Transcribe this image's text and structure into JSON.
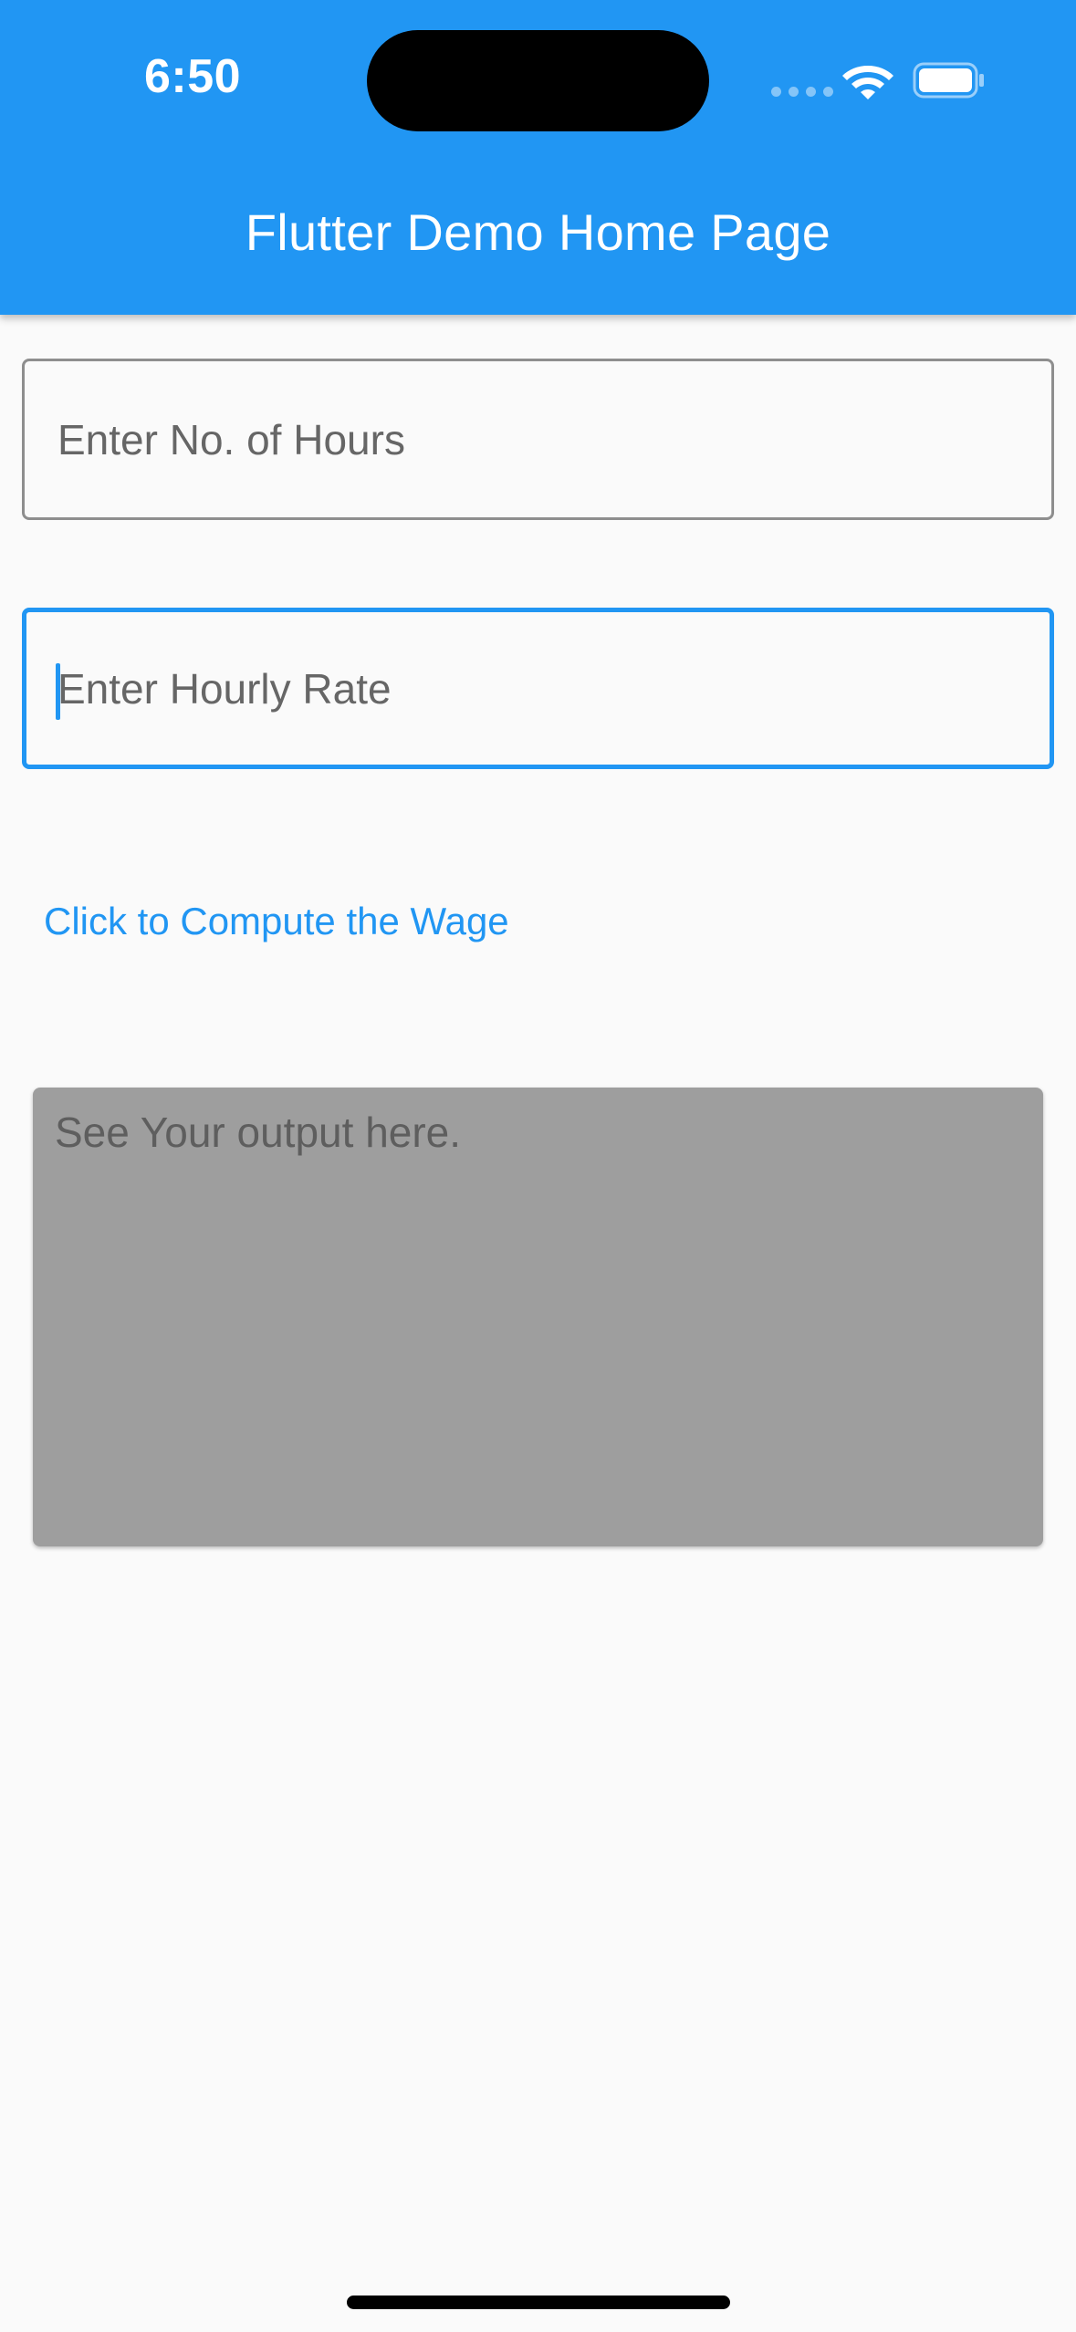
{
  "status_bar": {
    "time": "6:50",
    "icons": [
      "cellular-dots-icon",
      "wifi-icon",
      "battery-icon"
    ]
  },
  "app_bar": {
    "title": "Flutter Demo Home Page",
    "color": "#2196f3"
  },
  "form": {
    "hours_field": {
      "placeholder": "Enter No. of Hours",
      "value": ""
    },
    "rate_field": {
      "placeholder": "Enter Hourly Rate",
      "value": "",
      "focused": true
    },
    "compute_button_label": "Click to Compute the Wage"
  },
  "output": {
    "placeholder": "See Your output here.",
    "background": "#9e9e9e"
  },
  "colors": {
    "accent": "#2196f3",
    "background": "#fafafa",
    "field_border": "#8e8e8e"
  }
}
